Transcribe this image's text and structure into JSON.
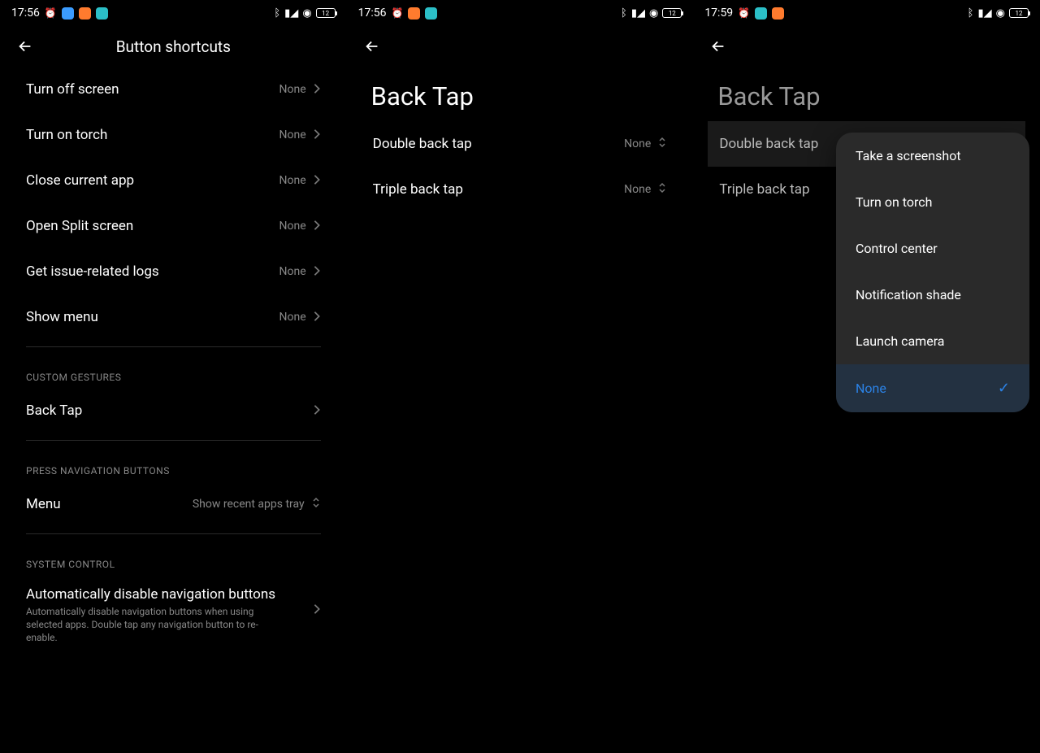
{
  "screen1": {
    "status": {
      "time": "17:56",
      "battery": "12"
    },
    "title": "Button shortcuts",
    "rows": [
      {
        "label": "Turn off screen",
        "value": "None"
      },
      {
        "label": "Turn on torch",
        "value": "None"
      },
      {
        "label": "Close current app",
        "value": "None"
      },
      {
        "label": "Open Split screen",
        "value": "None"
      },
      {
        "label": "Get issue-related logs",
        "value": "None"
      },
      {
        "label": "Show menu",
        "value": "None"
      }
    ],
    "section_custom": "CUSTOM GESTURES",
    "back_tap_label": "Back Tap",
    "section_nav": "PRESS NAVIGATION BUTTONS",
    "menu_label": "Menu",
    "menu_value": "Show recent apps tray",
    "section_sys": "SYSTEM CONTROL",
    "auto_disable_label": "Automatically disable navigation buttons",
    "auto_disable_sub": "Automatically disable navigation buttons when using selected apps. Double tap any navigation button to re-enable."
  },
  "screen2": {
    "status": {
      "time": "17:56",
      "battery": "12"
    },
    "title": "Back Tap",
    "double_label": "Double back tap",
    "double_value": "None",
    "triple_label": "Triple back tap",
    "triple_value": "None"
  },
  "screen3": {
    "status": {
      "time": "17:59",
      "battery": "12"
    },
    "title": "Back Tap",
    "double_label": "Double back tap",
    "triple_label": "Triple back tap",
    "popup": [
      {
        "label": "Take a screenshot",
        "selected": false
      },
      {
        "label": "Turn on torch",
        "selected": false
      },
      {
        "label": "Control center",
        "selected": false
      },
      {
        "label": "Notification shade",
        "selected": false
      },
      {
        "label": "Launch camera",
        "selected": false
      },
      {
        "label": "None",
        "selected": true
      }
    ]
  }
}
